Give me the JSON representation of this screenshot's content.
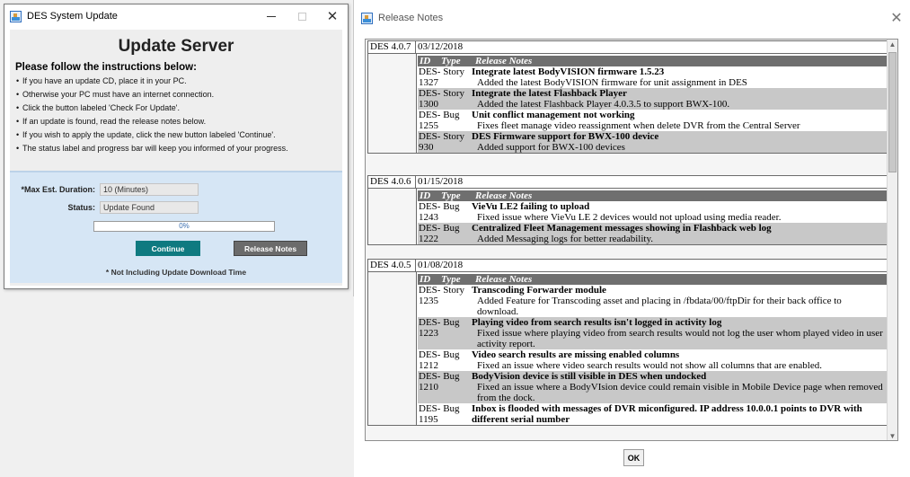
{
  "update_dialog": {
    "window_title": "DES System Update",
    "heading": "Update Server",
    "instructions_title": "Please follow the instructions below:",
    "instructions": [
      "If you have an update CD, place it in your PC.",
      "Otherwise your PC must have an internet connection.",
      "Click the button labeled 'Check For Update'.",
      "If an update is found, read the release notes below.",
      "If you wish to apply the update, click the new button labeled 'Continue'.",
      "The status label and progress bar will keep you informed of your progress."
    ],
    "max_duration_label": "*Max Est. Duration:",
    "max_duration_value": "10 (Minutes)",
    "status_label": "Status:",
    "status_value": "Update Found",
    "progress_percent": 0,
    "progress_text": "0%",
    "continue_label": "Continue",
    "release_notes_label": "Release Notes",
    "footnote": "* Not Including Update Download Time"
  },
  "release_notes": {
    "window_title": "Release Notes",
    "ok_label": "OK",
    "header": {
      "id": "ID",
      "type": "Type",
      "notes": "Release Notes"
    },
    "releases": [
      {
        "version": "DES 4.0.7",
        "date": "03/12/2018",
        "notes": [
          {
            "id_prefix": "DES-",
            "id_num": "1327",
            "type": "Story",
            "title": "Integrate latest BodyVISION firmware 1.5.23",
            "desc": "Added the latest BodyVISION firmware for unit assignment in DES"
          },
          {
            "id_prefix": "DES-",
            "id_num": "1300",
            "type": "Story",
            "title": "Integrate the latest Flashback Player",
            "desc": "Added the latest Flashback Player 4.0.3.5 to support BWX-100."
          },
          {
            "id_prefix": "DES-",
            "id_num": "1255",
            "type": "Bug",
            "title": "Unit conflict management not working",
            "desc": "Fixes fleet manage video reassignment when delete DVR from the Central Server"
          },
          {
            "id_prefix": "DES-",
            "id_num": "930",
            "type": "Story",
            "title": "DES Firmware support for BWX-100 device",
            "desc": "Added support for BWX-100 devices"
          }
        ]
      },
      {
        "version": "DES 4.0.6",
        "date": "01/15/2018",
        "notes": [
          {
            "id_prefix": "DES-",
            "id_num": "1243",
            "type": "Bug",
            "title": "VieVu LE2 failing to upload",
            "desc": "Fixed issue where VieVu LE 2 devices would not upload using media reader."
          },
          {
            "id_prefix": "DES-",
            "id_num": "1222",
            "type": "Bug",
            "title": "Centralized Fleet Management messages showing in Flashback web log",
            "desc": "Added Messaging logs for better readability."
          }
        ]
      },
      {
        "version": "DES 4.0.5",
        "date": "01/08/2018",
        "notes": [
          {
            "id_prefix": "DES-",
            "id_num": "1235",
            "type": "Story",
            "title": "Transcoding Forwarder module",
            "desc": "Added Feature for Transcoding asset and placing in /fbdata/00/ftpDir for their back office to download."
          },
          {
            "id_prefix": "DES-",
            "id_num": "1223",
            "type": "Bug",
            "title": "Playing video from search results isn't logged in activity log",
            "desc": "Fixed issue where playing video from search results would not log the user whom played video in user activity report."
          },
          {
            "id_prefix": "DES-",
            "id_num": "1212",
            "type": "Bug",
            "title": "Video search results are missing enabled columns",
            "desc": "Fixed an issue where video search results would not show all columns that are enabled."
          },
          {
            "id_prefix": "DES-",
            "id_num": "1210",
            "type": "Bug",
            "title": "BodyVision device is still visible in DES when undocked",
            "desc": "Fixed an issue where a BodyVIsion device could remain visible in Mobile Device page when removed from the dock."
          },
          {
            "id_prefix": "DES-",
            "id_num": "1195",
            "type": "Bug",
            "title": "Inbox is flooded with messages of DVR miconfigured. IP address 10.0.0.1 points to DVR with different serial number",
            "desc": ""
          }
        ]
      }
    ]
  }
}
